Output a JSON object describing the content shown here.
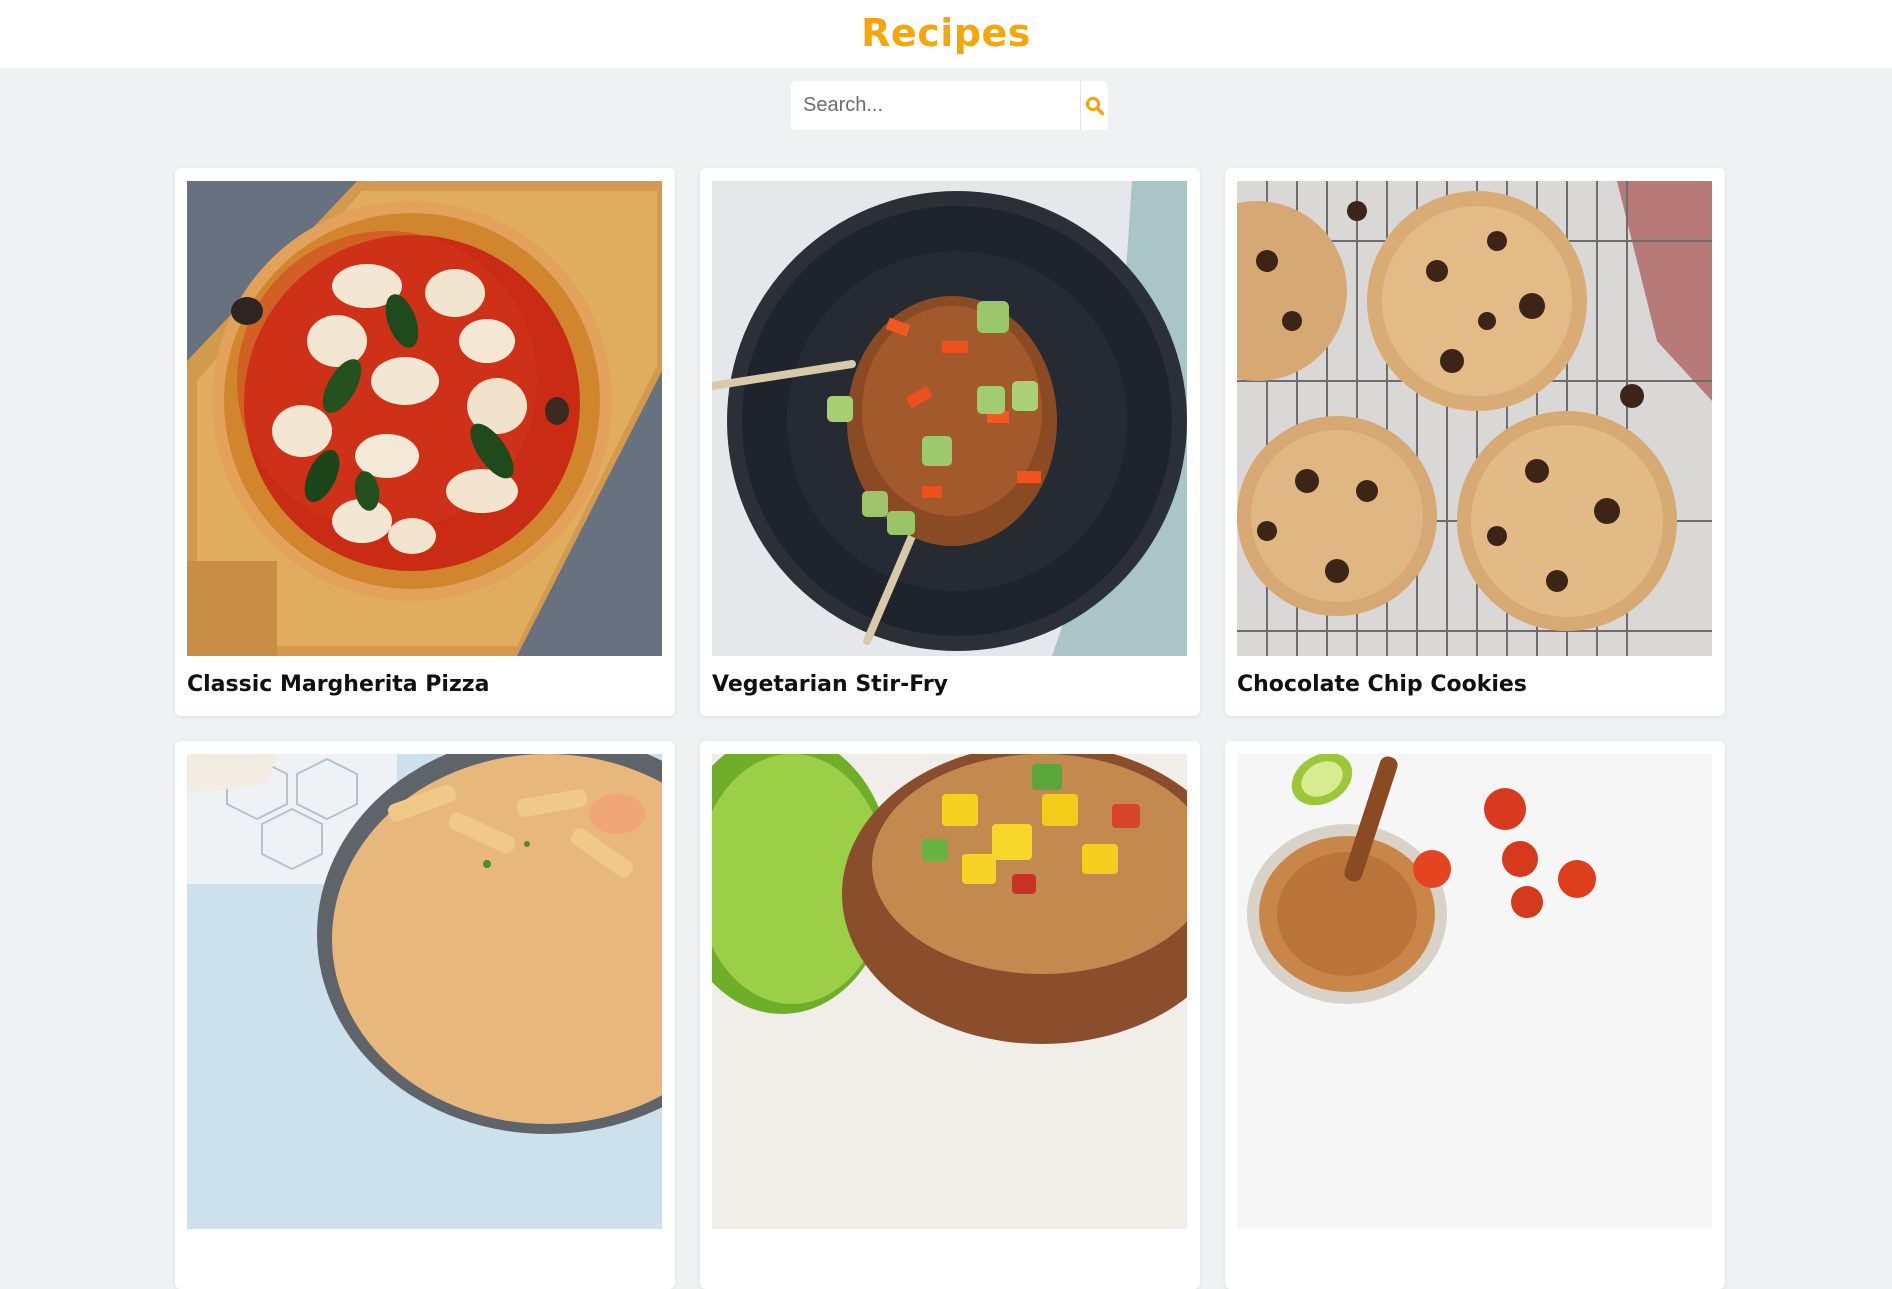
{
  "header": {
    "title": "Recipes",
    "accent_color": "#f5a60b"
  },
  "search": {
    "placeholder": "Search...",
    "value": "",
    "button_icon": "search-icon"
  },
  "recipes": [
    {
      "title": "Classic Margherita Pizza",
      "image": "pizza-photo"
    },
    {
      "title": "Vegetarian Stir-Fry",
      "image": "stir-fry-photo"
    },
    {
      "title": "Chocolate Chip Cookies",
      "image": "cookies-photo"
    },
    {
      "title": "",
      "image": "pasta-photo"
    },
    {
      "title": "",
      "image": "salsa-photo"
    },
    {
      "title": "",
      "image": "sauce-tomatoes-photo"
    }
  ]
}
